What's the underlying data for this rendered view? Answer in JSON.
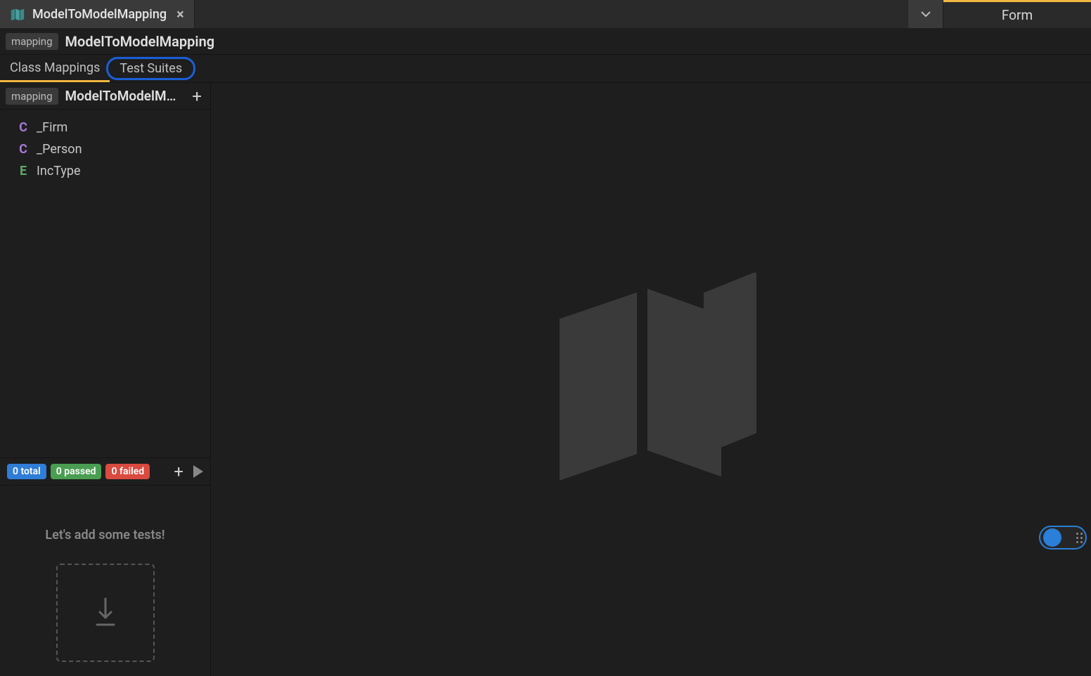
{
  "topbar": {
    "tab_title": "ModelToModelMapping",
    "form_label": "Form"
  },
  "breadcrumb": {
    "type_badge": "mapping",
    "name": "ModelToModelMapping"
  },
  "subtabs": {
    "class_mappings": "Class Mappings",
    "test_suites": "Test Suites"
  },
  "sidebar": {
    "type_badge": "mapping",
    "title": "ModelToModelM...",
    "classes": [
      {
        "type": "C",
        "name": "_Firm"
      },
      {
        "type": "C",
        "name": "_Person"
      },
      {
        "type": "E",
        "name": "IncType"
      }
    ]
  },
  "stats": {
    "total": "0 total",
    "passed": "0 passed",
    "failed": "0 failed"
  },
  "empty_tests": {
    "message": "Let's add some tests!"
  }
}
